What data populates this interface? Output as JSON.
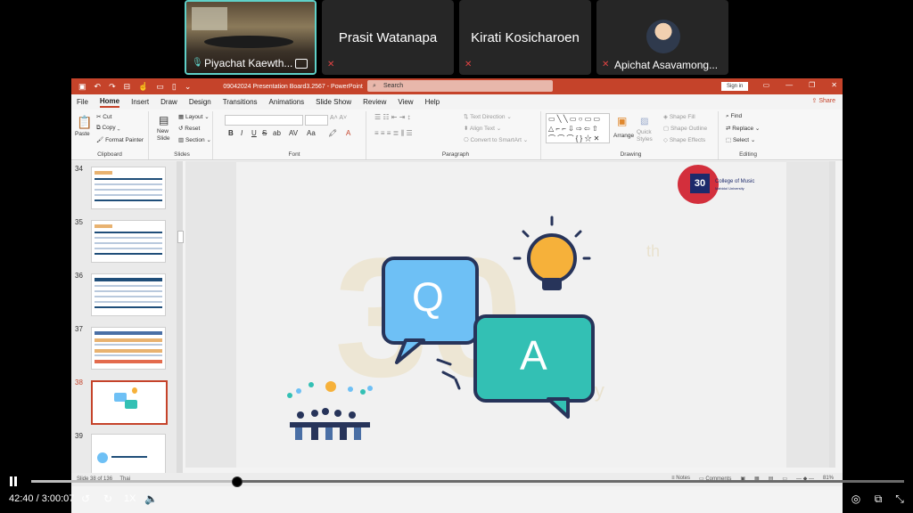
{
  "participants": [
    {
      "name": "Piyachat Kaewth...",
      "video": true,
      "muted": false
    },
    {
      "name": "Prasit Watanapa",
      "video": false,
      "muted": true
    },
    {
      "name": "Kirati Kosicharoen",
      "video": false,
      "muted": true
    },
    {
      "name": "Apichat Asavamong...",
      "video": false,
      "muted": true,
      "avatar": true
    }
  ],
  "ppt": {
    "document_title": "09042024 Presentation Board3.2567  -  PowerPoint",
    "search_placeholder": "Search",
    "sign_in": "Sign in",
    "share": "Share",
    "tabs": [
      "File",
      "Home",
      "Insert",
      "Draw",
      "Design",
      "Transitions",
      "Animations",
      "Slide Show",
      "Review",
      "View",
      "Help"
    ],
    "active_tab": "Home",
    "ribbon": {
      "clipboard": {
        "label": "Clipboard",
        "paste": "Paste",
        "cut": "Cut",
        "copy": "Copy",
        "format_painter": "Format Painter"
      },
      "slides": {
        "label": "Slides",
        "new_slide": "New Slide",
        "layout": "Layout",
        "reset": "Reset",
        "section": "Section"
      },
      "font": {
        "label": "Font"
      },
      "paragraph": {
        "label": "Paragraph",
        "text_direction": "Text Direction",
        "align_text": "Align Text",
        "convert_smartart": "Convert to SmartArt"
      },
      "drawing": {
        "label": "Drawing",
        "arrange": "Arrange",
        "quick_styles": "Quick Styles",
        "shape_fill": "Shape Fill",
        "shape_outline": "Shape Outline",
        "shape_effects": "Shape Effects"
      },
      "editing": {
        "label": "Editing",
        "find": "Find",
        "replace": "Replace",
        "select": "Select"
      }
    },
    "thumbnails": [
      {
        "num": "34"
      },
      {
        "num": "35"
      },
      {
        "num": "36"
      },
      {
        "num": "37"
      },
      {
        "num": "38",
        "selected": true
      },
      {
        "num": "39"
      }
    ],
    "slide": {
      "q_letter": "Q",
      "a_letter": "A",
      "logo_line1": "College of Music",
      "logo_line2": "Mahidol University",
      "logo_number": "30",
      "watermark_th": "th",
      "watermark_word": "rsary"
    },
    "status": {
      "slide_info": "Slide 38 of 136",
      "language": "Thai",
      "notes": "Notes",
      "comments": "Comments",
      "zoom": "81%"
    }
  },
  "player": {
    "current_time": "42:40",
    "total_time": "3:00:07",
    "time_separator": "/",
    "speed": "1X",
    "progress": 0.235
  },
  "colors": {
    "ppt_accent": "#c5432a",
    "q_bubble": "#6ec0f5",
    "a_bubble": "#33c0b4",
    "bulb": "#f6b13a",
    "active_tile": "#5fd0c8"
  }
}
